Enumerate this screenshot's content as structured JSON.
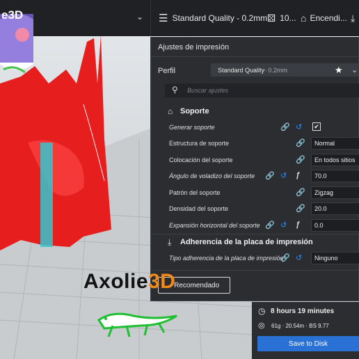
{
  "topbar": {
    "quality": "Standard Quality - 0.2mm",
    "infill": "10...",
    "support": "Encendi..."
  },
  "logo": {
    "corner": "e3D",
    "brand_prefix": "Axolie",
    "brand_suffix": "3D"
  },
  "panel": {
    "title": "Ajustes de impresión",
    "profile_label": "Perfil",
    "profile_value": "Standard Quality",
    "profile_sub": " - 0.2mm",
    "search_placeholder": "Buscar ajustes",
    "support_section": "Soporte",
    "adhesion_section": "Adherencia de la placa de impresión",
    "rows": [
      {
        "label": "Generar soporte",
        "value": ""
      },
      {
        "label": "Estructura de soporte",
        "value": "Normal"
      },
      {
        "label": "Colocación del soporte",
        "value": "En todos sitios"
      },
      {
        "label": "Ángulo de voladizo del soporte",
        "value": "70.0"
      },
      {
        "label": "Patrón del soporte",
        "value": "Zigzag"
      },
      {
        "label": "Densidad del soporte",
        "value": "20.0"
      },
      {
        "label": "Expansión horizontal del soporte",
        "value": "0.0"
      },
      {
        "label": "Tipo adherencia de la placa de impresión",
        "value": "Ninguno"
      }
    ],
    "recommended_button": "Recomendado"
  },
  "estimate": {
    "time": "8 hours 19 minutes",
    "material": "61g · 20.54m · BS 9.77"
  },
  "save_button": "Save to Disk",
  "colors": {
    "model": "#e61e1e",
    "support": "#35c6cc",
    "accent": "#2a71d6",
    "reset": "#3b8cf0"
  }
}
